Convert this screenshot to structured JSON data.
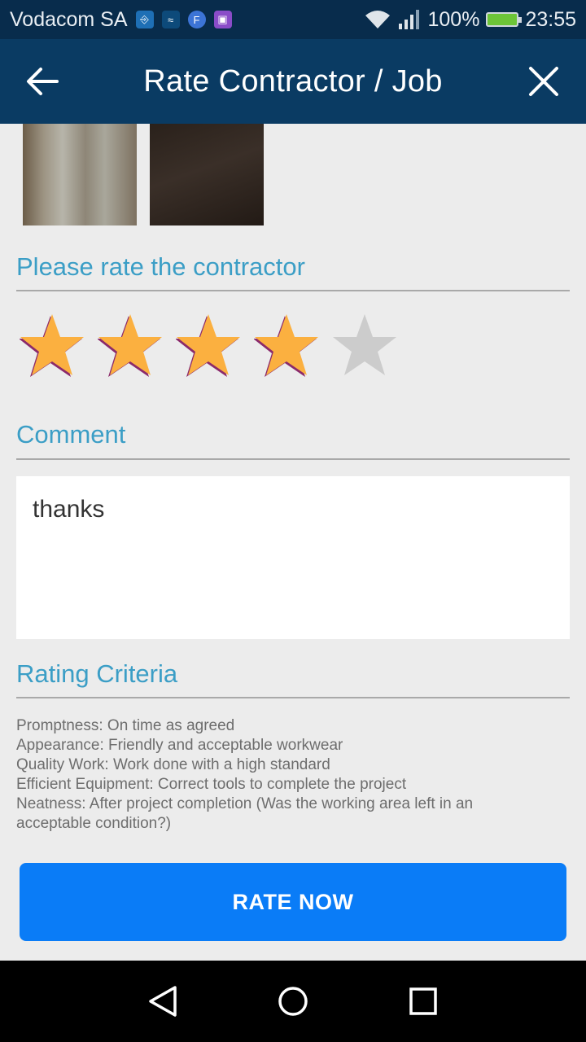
{
  "status_bar": {
    "carrier": "Vodacom SA",
    "battery": "100%",
    "time": "23:55"
  },
  "app_bar": {
    "title": "Rate Contractor / Job"
  },
  "rating": {
    "heading": "Please rate the contractor",
    "value": 4,
    "max": 5
  },
  "comment": {
    "heading": "Comment",
    "value": "thanks"
  },
  "criteria": {
    "heading": "Rating Criteria",
    "lines": [
      "Promptness: On time as agreed",
      "Appearance: Friendly and acceptable workwear",
      "Quality Work: Work done with a high standard",
      "Efficient Equipment: Correct tools to complete the project",
      "Neatness: After project completion (Was the working area left in an",
      "acceptable condition?)"
    ]
  },
  "action": {
    "label": "RATE NOW"
  },
  "colors": {
    "accent": "#3b9ec6",
    "button": "#0a7cf7",
    "star_filled": "#fbb040",
    "star_empty": "#cccccc",
    "app_bar": "#0a3b63"
  }
}
